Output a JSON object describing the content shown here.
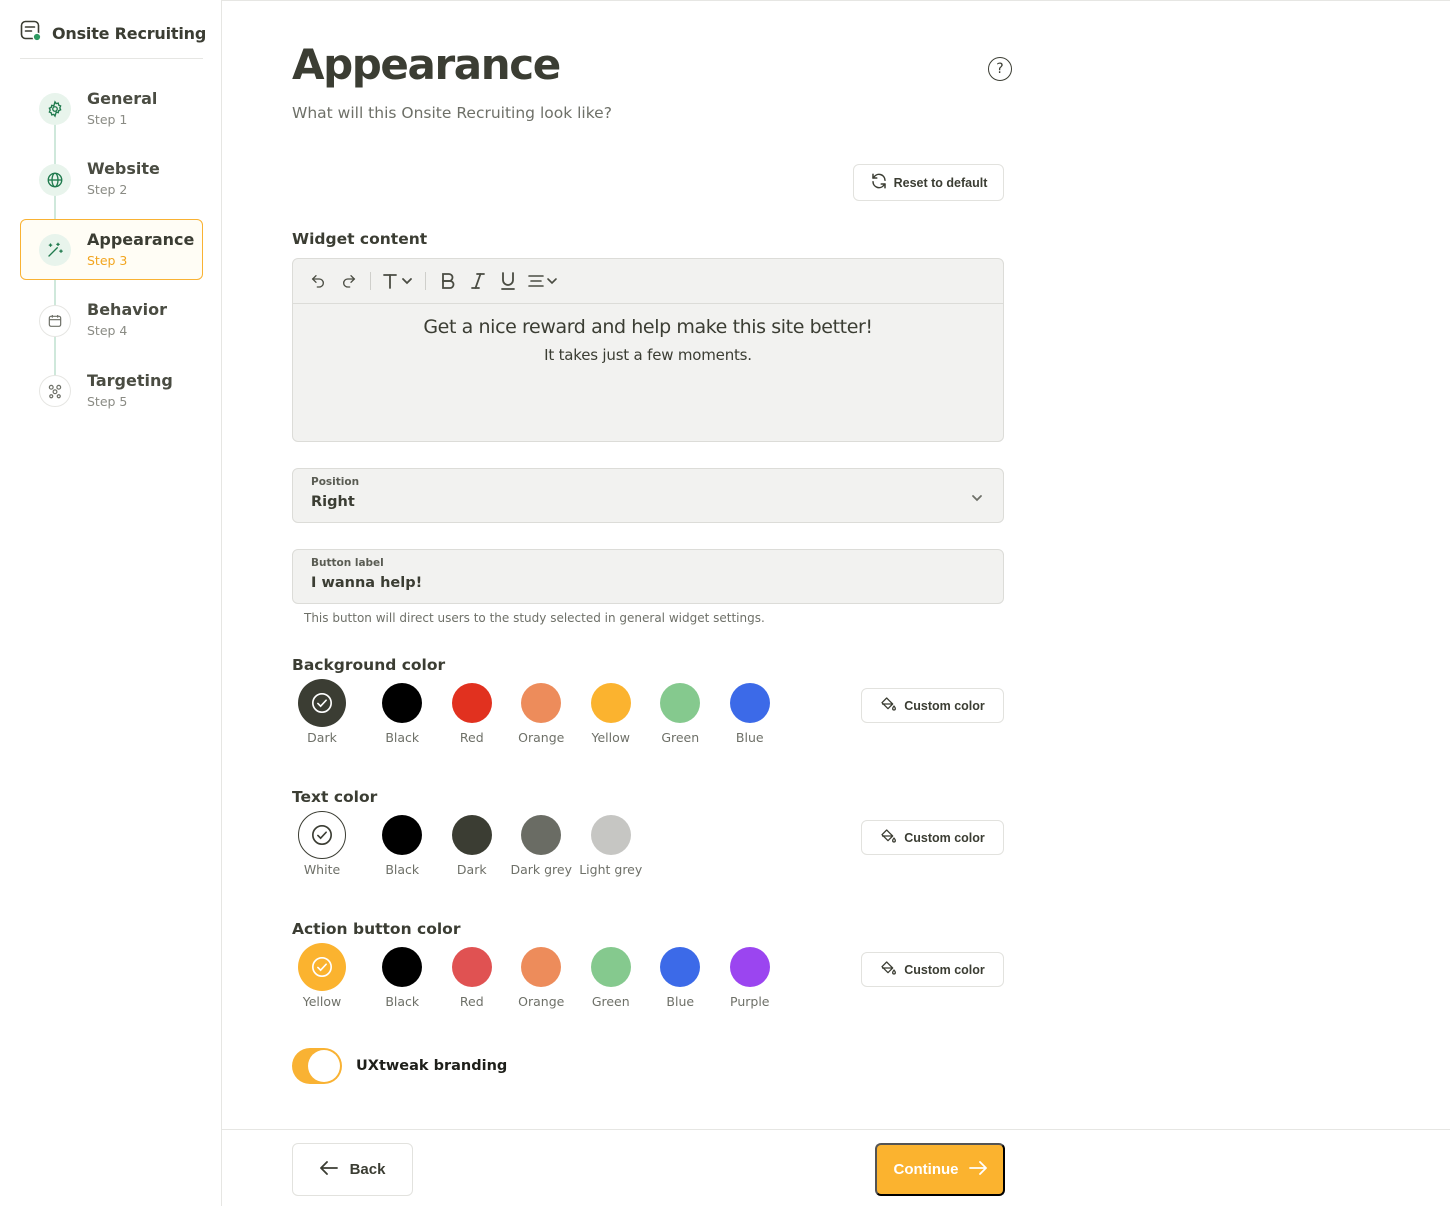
{
  "app": {
    "title": "Onsite Recruiting"
  },
  "steps": [
    {
      "name": "General",
      "sub": "Step 1",
      "icon": "gear-icon",
      "active": false
    },
    {
      "name": "Website",
      "sub": "Step 2",
      "icon": "globe-icon",
      "active": false
    },
    {
      "name": "Appearance",
      "sub": "Step 3",
      "icon": "magic-wand-icon",
      "active": true
    },
    {
      "name": "Behavior",
      "sub": "Step 4",
      "icon": "calendar-icon",
      "active": false
    },
    {
      "name": "Targeting",
      "sub": "Step 5",
      "icon": "users-icon",
      "active": false
    }
  ],
  "page": {
    "title": "Appearance",
    "subtitle": "What will this Onsite Recruiting look like?",
    "reset_label": "Reset to default"
  },
  "widget": {
    "label": "Widget content",
    "heading": "Get a nice reward and help make this site better!",
    "body": "It takes just a few moments."
  },
  "position": {
    "label": "Position",
    "value": "Right"
  },
  "button_label": {
    "label": "Button label",
    "value": "I wanna help!",
    "hint": "This button will direct users to the study selected in general widget settings."
  },
  "background_color": {
    "label": "Background color",
    "custom_label": "Custom color",
    "options": [
      {
        "name": "Dark",
        "hex": "#3b3d33",
        "selected": true
      },
      {
        "name": "Black",
        "hex": "#000000",
        "selected": false
      },
      {
        "name": "Red",
        "hex": "#e1311f",
        "selected": false
      },
      {
        "name": "Orange",
        "hex": "#ed8c5b",
        "selected": false
      },
      {
        "name": "Yellow",
        "hex": "#fbb32f",
        "selected": false
      },
      {
        "name": "Green",
        "hex": "#85c98e",
        "selected": false
      },
      {
        "name": "Blue",
        "hex": "#3c6ae8",
        "selected": false
      }
    ]
  },
  "text_color": {
    "label": "Text color",
    "custom_label": "Custom color",
    "options": [
      {
        "name": "White",
        "hex": "#ffffff",
        "selected": true
      },
      {
        "name": "Black",
        "hex": "#000000",
        "selected": false
      },
      {
        "name": "Dark",
        "hex": "#3b3d33",
        "selected": false
      },
      {
        "name": "Dark grey",
        "hex": "#6a6c64",
        "selected": false
      },
      {
        "name": "Light grey",
        "hex": "#c6c6c3",
        "selected": false
      }
    ]
  },
  "action_color": {
    "label": "Action button color",
    "custom_label": "Custom color",
    "options": [
      {
        "name": "Yellow",
        "hex": "#fbb32f",
        "selected": true
      },
      {
        "name": "Black",
        "hex": "#000000",
        "selected": false
      },
      {
        "name": "Red",
        "hex": "#e05252",
        "selected": false
      },
      {
        "name": "Orange",
        "hex": "#ed8c5b",
        "selected": false
      },
      {
        "name": "Green",
        "hex": "#85c98e",
        "selected": false
      },
      {
        "name": "Blue",
        "hex": "#3c6ae8",
        "selected": false
      },
      {
        "name": "Purple",
        "hex": "#9b45f0",
        "selected": false
      }
    ]
  },
  "branding": {
    "label": "UXtweak branding",
    "enabled": true
  },
  "footer": {
    "back_label": "Back",
    "continue_label": "Continue"
  },
  "colors": {
    "accent": "#fbb32f",
    "brand_green": "#1f7a4d"
  }
}
